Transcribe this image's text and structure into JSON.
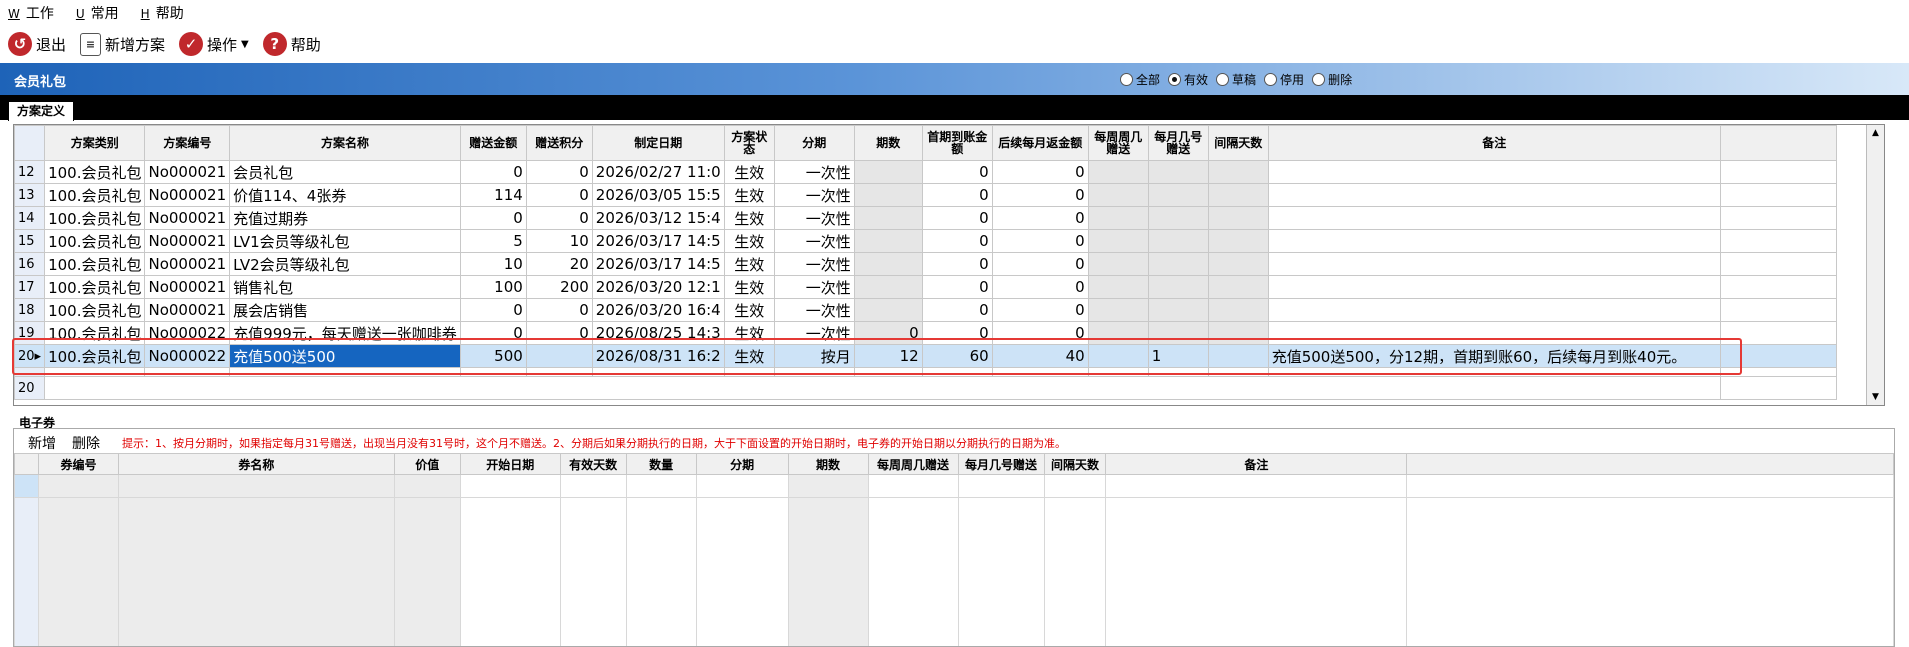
{
  "menu": [
    {
      "key": "W",
      "label": "工作"
    },
    {
      "key": "U",
      "label": "常用"
    },
    {
      "key": "H",
      "label": "帮助"
    }
  ],
  "toolbar": {
    "exit": "退出",
    "new_plan": "新增方案",
    "operate": "操作",
    "help": "帮助"
  },
  "window_title": "会员礼包",
  "filters": {
    "all": "全部",
    "valid": "有效",
    "draft": "草稿",
    "disabled": "停用",
    "deleted": "删除",
    "selected": "有效"
  },
  "tab": "方案定义",
  "grid": {
    "headers": [
      "方案类别",
      "方案编号",
      "方案名称",
      "赠送金额",
      "赠送积分",
      "制定日期",
      "方案状态",
      "分期",
      "期数",
      "首期到账金额",
      "后续每月返金额",
      "每周周几赠送",
      "每月几号赠送",
      "间隔天数",
      "备注"
    ],
    "rows": [
      {
        "n": "12",
        "cat": "100.会员礼包",
        "code": "No000021",
        "name": "会员礼包",
        "amount": "0",
        "points": "0",
        "date": "2026/02/27 11:0",
        "status": "生效",
        "stage": "一次性",
        "periods": "",
        "first": "0",
        "monthly": "0",
        "weekday": "",
        "monthday": "",
        "interval": "",
        "remark": ""
      },
      {
        "n": "13",
        "cat": "100.会员礼包",
        "code": "No000021",
        "name": "价值114、4张券",
        "amount": "114",
        "points": "0",
        "date": "2026/03/05 15:5",
        "status": "生效",
        "stage": "一次性",
        "periods": "",
        "first": "0",
        "monthly": "0",
        "weekday": "",
        "monthday": "",
        "interval": "",
        "remark": ""
      },
      {
        "n": "14",
        "cat": "100.会员礼包",
        "code": "No000021",
        "name": "充值过期券",
        "amount": "0",
        "points": "0",
        "date": "2026/03/12 15:4",
        "status": "生效",
        "stage": "一次性",
        "periods": "",
        "first": "0",
        "monthly": "0",
        "weekday": "",
        "monthday": "",
        "interval": "",
        "remark": ""
      },
      {
        "n": "15",
        "cat": "100.会员礼包",
        "code": "No000021",
        "name": "LV1会员等级礼包",
        "amount": "5",
        "points": "10",
        "date": "2026/03/17 14:5",
        "status": "生效",
        "stage": "一次性",
        "periods": "",
        "first": "0",
        "monthly": "0",
        "weekday": "",
        "monthday": "",
        "interval": "",
        "remark": ""
      },
      {
        "n": "16",
        "cat": "100.会员礼包",
        "code": "No000021",
        "name": "LV2会员等级礼包",
        "amount": "10",
        "points": "20",
        "date": "2026/03/17 14:5",
        "status": "生效",
        "stage": "一次性",
        "periods": "",
        "first": "0",
        "monthly": "0",
        "weekday": "",
        "monthday": "",
        "interval": "",
        "remark": ""
      },
      {
        "n": "17",
        "cat": "100.会员礼包",
        "code": "No000021",
        "name": "销售礼包",
        "amount": "100",
        "points": "200",
        "date": "2026/03/20 12:1",
        "status": "生效",
        "stage": "一次性",
        "periods": "",
        "first": "0",
        "monthly": "0",
        "weekday": "",
        "monthday": "",
        "interval": "",
        "remark": ""
      },
      {
        "n": "18",
        "cat": "100.会员礼包",
        "code": "No000021",
        "name": "展会店销售",
        "amount": "0",
        "points": "0",
        "date": "2026/03/20 16:4",
        "status": "生效",
        "stage": "一次性",
        "periods": "",
        "first": "0",
        "monthly": "0",
        "weekday": "",
        "monthday": "",
        "interval": "",
        "remark": ""
      },
      {
        "n": "19",
        "cat": "100.会员礼包",
        "code": "No000022",
        "name": "充值999元，每天赠送一张咖啡券",
        "amount": "0",
        "points": "0",
        "date": "2026/08/25 14:3",
        "status": "生效",
        "stage": "一次性",
        "periods": "0",
        "first": "0",
        "monthly": "0",
        "weekday": "",
        "monthday": "",
        "interval": "",
        "remark": ""
      }
    ],
    "selected_row": {
      "n": "20",
      "cat": "100.会员礼包",
      "code": "No000022",
      "name": "充值500送500",
      "amount": "500",
      "points": "",
      "date": "2026/08/31 16:2",
      "status": "生效",
      "stage": "按月",
      "periods": "12",
      "first": "60",
      "monthly": "40",
      "weekday": "",
      "monthday": "1",
      "interval": "",
      "remark": "充值500送500，分12期，首期到账60，后续每月到账40元。"
    },
    "footer_count": "20"
  },
  "coupon_section": {
    "tab": "电子券",
    "add": "新增",
    "delete": "删除",
    "hint": "提示：1、按月分期时，如果指定每月31号赠送，出现当月没有31号时，这个月不赠送。2、分期后如果分期执行的日期，大于下面设置的开始日期时，电子券的开始日期以分期执行的日期为准。",
    "headers": [
      "券编号",
      "券名称",
      "价值",
      "开始日期",
      "有效天数",
      "数量",
      "分期",
      "期数",
      "每周周几赠送",
      "每月几号赠送",
      "间隔天数",
      "备注"
    ]
  },
  "colors": {
    "title_bar": "#1e63b8",
    "selection": "#cde3f7",
    "highlight_box": "#e53935",
    "hint": "#e00000"
  }
}
